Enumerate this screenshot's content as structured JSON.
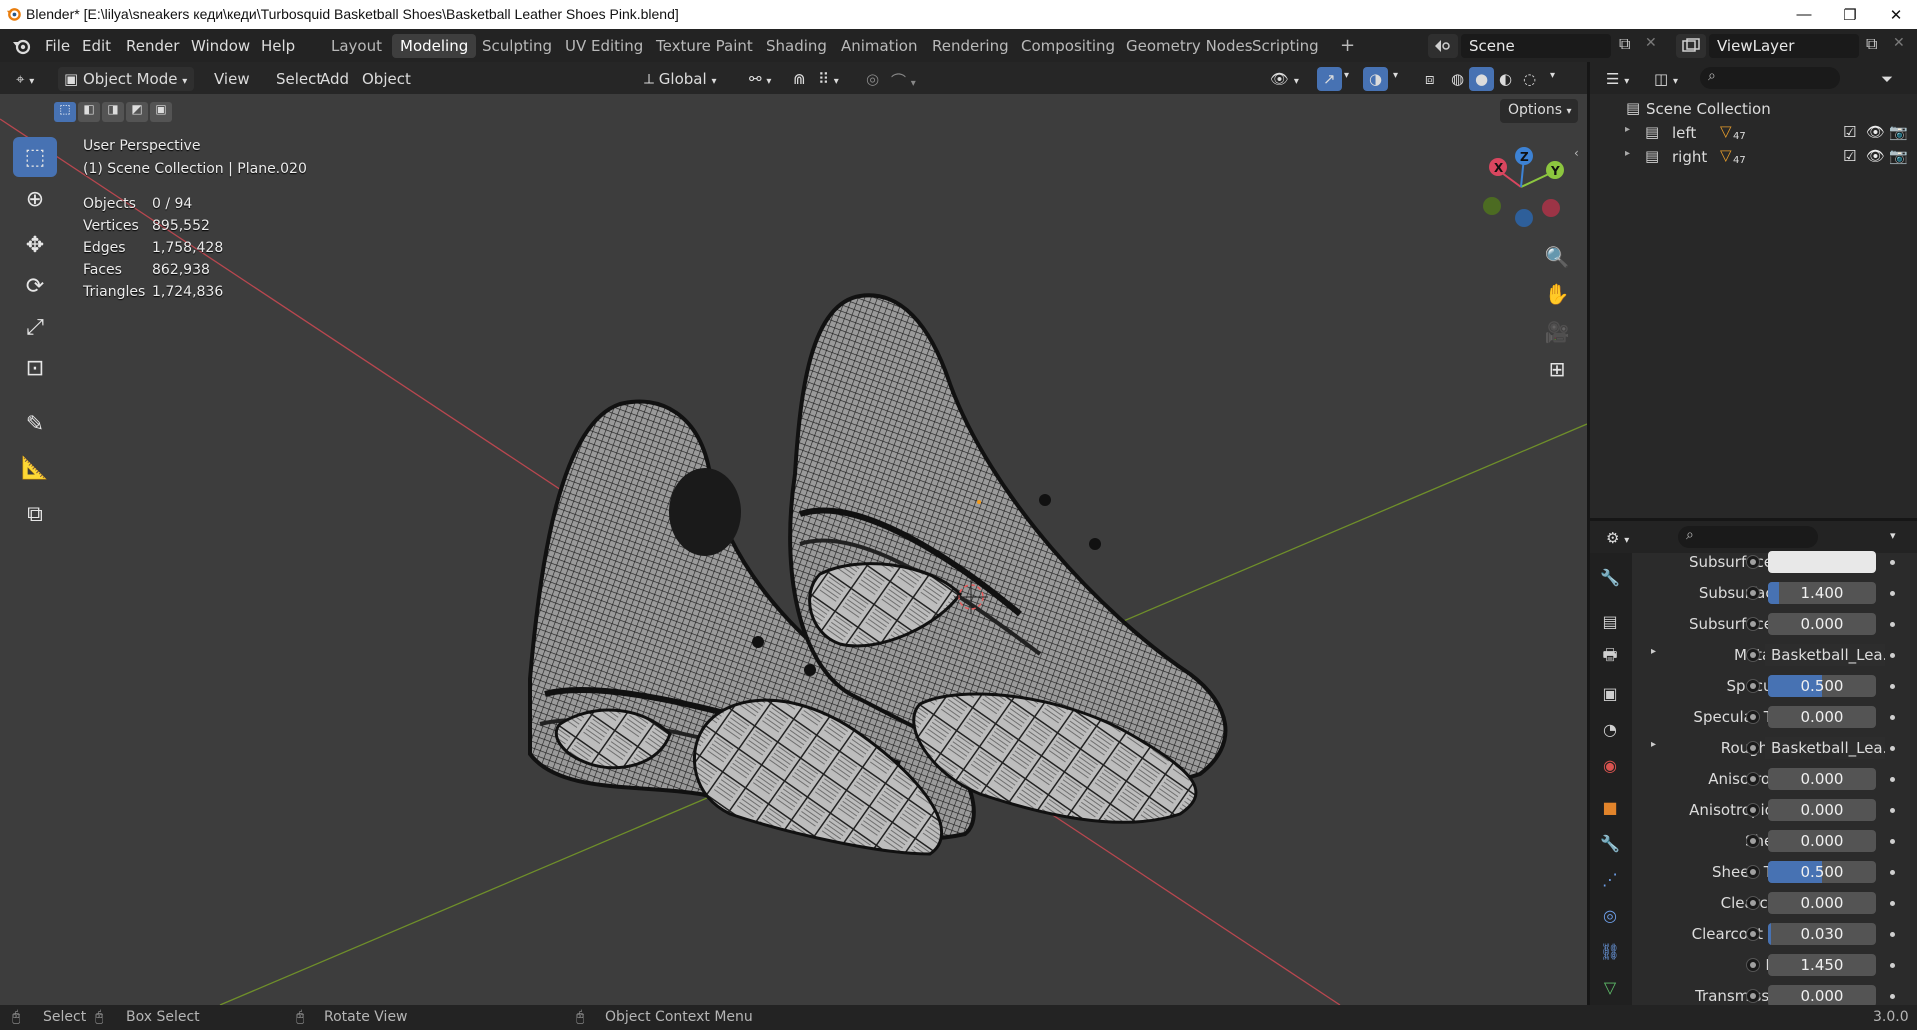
{
  "window": {
    "title": "Blender* [E:\\lilya\\sneakers кеди\\кеди\\Turbosquid Basketball Shoes\\Basketball Leather Shoes Pink.blend]",
    "minimize": "—",
    "maximize": "❐",
    "close": "✕"
  },
  "menu": {
    "file": "File",
    "edit": "Edit",
    "render": "Render",
    "window": "Window",
    "help": "Help"
  },
  "workspaces": [
    {
      "label": "Layout"
    },
    {
      "label": "Modeling"
    },
    {
      "label": "Sculpting"
    },
    {
      "label": "UV Editing"
    },
    {
      "label": "Texture Paint"
    },
    {
      "label": "Shading"
    },
    {
      "label": "Animation"
    },
    {
      "label": "Rendering"
    },
    {
      "label": "Compositing"
    },
    {
      "label": "Geometry Nodes"
    },
    {
      "label": "Scripting"
    }
  ],
  "workspace_active": "Modeling",
  "add_workspace": "+",
  "scene": {
    "label": "Scene"
  },
  "viewlayer": {
    "label": "ViewLayer"
  },
  "viewport_header": {
    "mode": "Object Mode",
    "view": "View",
    "select": "Select",
    "add": "Add",
    "object": "Object",
    "orientation": "Global",
    "options": "Options"
  },
  "viewport_overlay": {
    "perspective": "User Perspective",
    "collection": "(1) Scene Collection | Plane.020",
    "stats": [
      {
        "label": "Objects",
        "value": "0 / 94"
      },
      {
        "label": "Vertices",
        "value": "895,552"
      },
      {
        "label": "Edges",
        "value": "1,758,428"
      },
      {
        "label": "Faces",
        "value": "862,938"
      },
      {
        "label": "Triangles",
        "value": "1,724,836"
      }
    ]
  },
  "gizmo": {
    "x": "X",
    "y": "Y",
    "z": "Z"
  },
  "outliner": {
    "root": "Scene Collection",
    "items": [
      {
        "label": "left",
        "count": "47"
      },
      {
        "label": "right",
        "count": "47"
      }
    ]
  },
  "properties": {
    "rows": [
      {
        "label": "Subsurface ...",
        "value": "",
        "fill": 0
      },
      {
        "label": "Subsurface I",
        "value": "1.400",
        "fill": 0.1
      },
      {
        "label": "Subsurface ...",
        "value": "0.000",
        "fill": 0
      },
      {
        "label": "Metallic",
        "link": "Basketball_Lea...",
        "expand": true
      },
      {
        "label": "Specular",
        "value": "0.500",
        "fill": 0.5
      },
      {
        "label": "Specular Tint",
        "value": "0.000",
        "fill": 0
      },
      {
        "label": "Roughn...",
        "link": "Basketball_Lea...",
        "expand": true
      },
      {
        "label": "Anisotropic",
        "value": "0.000",
        "fill": 0
      },
      {
        "label": "Anisotropic ...",
        "value": "0.000",
        "fill": 0
      },
      {
        "label": "Sheen",
        "value": "0.000",
        "fill": 0
      },
      {
        "label": "Sheen Tint",
        "value": "0.500",
        "fill": 0.5
      },
      {
        "label": "Clearcoat",
        "value": "0.000",
        "fill": 0
      },
      {
        "label": "Clearcoat R...",
        "value": "0.030",
        "fill": 0.03
      },
      {
        "label": "IOR",
        "value": "1.450",
        "fill": 0
      },
      {
        "label": "Transmission",
        "value": "0.000",
        "fill": 0
      }
    ]
  },
  "statusbar": {
    "select": "Select",
    "box_select": "Box Select",
    "rotate_view": "Rotate View",
    "context_menu": "Object Context Menu",
    "version": "3.0.0"
  },
  "colors": {
    "accent": "#4772b3",
    "x_axis": "#d9465f",
    "y_axis": "#8cc63f",
    "z_axis": "#3d82d4"
  }
}
